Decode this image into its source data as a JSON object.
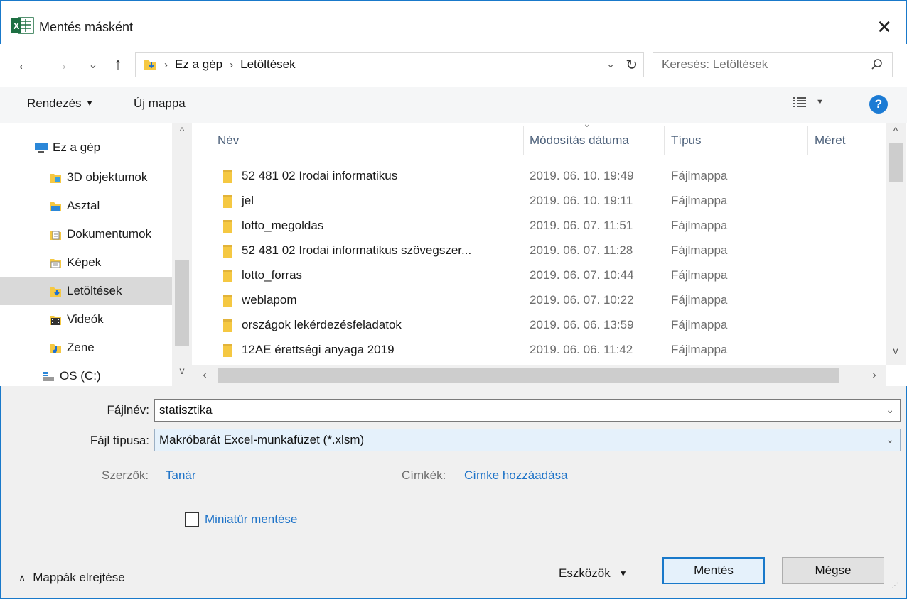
{
  "window": {
    "title": "Mentés másként",
    "app_icon": "excel-icon",
    "close_glyph": "✕"
  },
  "nav": {
    "back_glyph": "←",
    "forward_glyph": "→",
    "recent_glyph": "⌄",
    "up_glyph": "↑",
    "breadcrumbs": [
      "Ez a gép",
      "Letöltések"
    ],
    "crumb_sep": "›",
    "search_placeholder": "Keresés: Letöltések"
  },
  "toolbar": {
    "organize_label": "Rendezés",
    "new_folder_label": "Új mappa"
  },
  "sidebar": {
    "items": [
      {
        "label": "Ez a gép",
        "icon": "computer-icon",
        "selected": false
      },
      {
        "label": "3D objektumok",
        "icon": "3d-objects-icon",
        "selected": false
      },
      {
        "label": "Asztal",
        "icon": "desktop-icon",
        "selected": false
      },
      {
        "label": "Dokumentumok",
        "icon": "documents-icon",
        "selected": false
      },
      {
        "label": "Képek",
        "icon": "pictures-icon",
        "selected": false
      },
      {
        "label": "Letöltések",
        "icon": "downloads-icon",
        "selected": true
      },
      {
        "label": "Videók",
        "icon": "videos-icon",
        "selected": false
      },
      {
        "label": "Zene",
        "icon": "music-icon",
        "selected": false
      },
      {
        "label": "OS (C:)",
        "icon": "drive-icon",
        "selected": false
      }
    ]
  },
  "filelist": {
    "columns": [
      "Név",
      "Módosítás dátuma",
      "Típus",
      "Méret"
    ],
    "rows": [
      {
        "name": "52 481 02 Irodai informatikus",
        "date": "2019. 06. 10. 19:49",
        "type": "Fájlmappa"
      },
      {
        "name": "jel",
        "date": "2019. 06. 10. 19:11",
        "type": "Fájlmappa"
      },
      {
        "name": "lotto_megoldas",
        "date": "2019. 06. 07. 11:51",
        "type": "Fájlmappa"
      },
      {
        "name": "52 481 02 Irodai informatikus szövegszer...",
        "date": "2019. 06. 07. 11:28",
        "type": "Fájlmappa"
      },
      {
        "name": "lotto_forras",
        "date": "2019. 06. 07. 10:44",
        "type": "Fájlmappa"
      },
      {
        "name": "weblapom",
        "date": "2019. 06. 07. 10:22",
        "type": "Fájlmappa"
      },
      {
        "name": "országok lekérdezésfeladatok",
        "date": "2019. 06. 06. 13:59",
        "type": "Fájlmappa"
      },
      {
        "name": "12AE érettségi anyaga 2019",
        "date": "2019. 06. 06. 11:42",
        "type": "Fájlmappa"
      }
    ]
  },
  "form": {
    "filename_label": "Fájlnév:",
    "filename_value": "statisztika",
    "filetype_label": "Fájl típusa:",
    "filetype_value": "Makróbarát Excel-munkafüzet (*.xlsm)",
    "authors_label": "Szerzők:",
    "authors_value": "Tanár",
    "tags_label": "Címkék:",
    "tags_value": "Címke hozzáadása",
    "thumbnail_label": "Miniatűr mentése",
    "thumbnail_checked": false
  },
  "footer": {
    "hide_folders_label": "Mappák elrejtése",
    "tools_label": "Eszközök",
    "save_label": "Mentés",
    "cancel_label": "Mégse"
  },
  "colors": {
    "accent": "#1979ca",
    "folder": "#f5c842",
    "link": "#1e73c8",
    "help": "#1c7bd4"
  }
}
